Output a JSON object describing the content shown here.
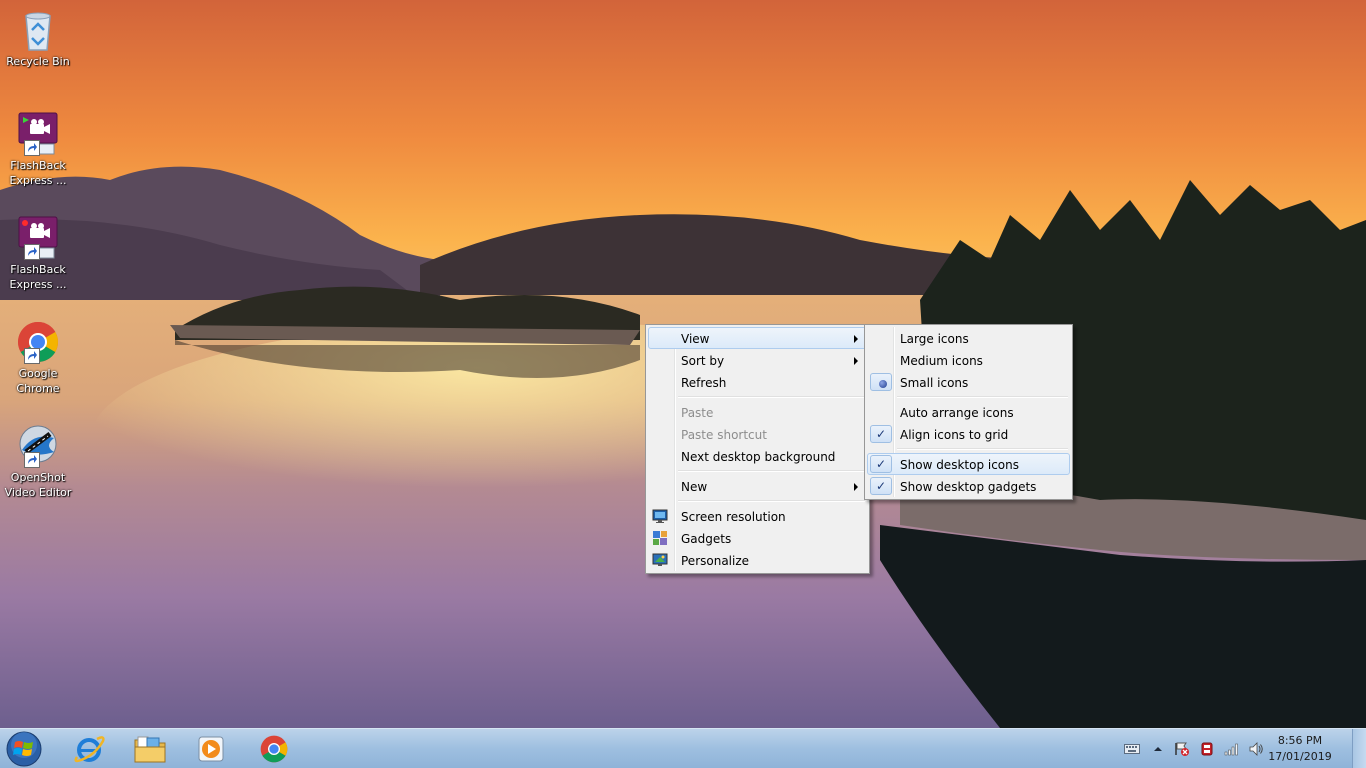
{
  "desktop": {
    "icons": [
      {
        "id": "recycle-bin",
        "label": "Recycle Bin",
        "icon": "recycle-bin-icon"
      },
      {
        "id": "flashback-recorder",
        "label": "FlashBack Express ...",
        "icon": "flashback-recorder-icon"
      },
      {
        "id": "flashback-player",
        "label": "FlashBack Express ...",
        "icon": "flashback-player-icon"
      },
      {
        "id": "google-chrome",
        "label": "Google Chrome",
        "icon": "chrome-icon"
      },
      {
        "id": "openshot",
        "label": "OpenShot Video Editor",
        "icon": "openshot-icon"
      }
    ]
  },
  "context_menu": {
    "items": {
      "view": "View",
      "sort_by": "Sort by",
      "refresh": "Refresh",
      "paste": "Paste",
      "paste_shortcut": "Paste shortcut",
      "next_background": "Next desktop background",
      "new": "New",
      "screen_resolution": "Screen resolution",
      "gadgets": "Gadgets",
      "personalize": "Personalize"
    },
    "disabled": [
      "Paste",
      "Paste shortcut"
    ],
    "highlighted": "View"
  },
  "view_submenu": {
    "items": {
      "large_icons": "Large icons",
      "medium_icons": "Medium icons",
      "small_icons": "Small icons",
      "auto_arrange": "Auto arrange icons",
      "align_grid": "Align icons to grid",
      "show_icons": "Show desktop icons",
      "show_gadgets": "Show desktop gadgets"
    },
    "selected_size": "Small icons",
    "checked": [
      "Align icons to grid",
      "Show desktop icons",
      "Show desktop gadgets"
    ],
    "highlighted": "Show desktop icons",
    "check_mark": "✓"
  },
  "taskbar": {
    "pinned": [
      "internet-explorer-icon",
      "file-explorer-icon",
      "media-player-icon",
      "chrome-icon"
    ],
    "clock": {
      "time": "8:56 PM",
      "date": "17/01/2019"
    },
    "tray_icons": [
      "keyboard-icon",
      "show-hidden-icons-arrow",
      "action-center-icon",
      "antivirus-icon",
      "network-signal-icon",
      "volume-icon"
    ]
  },
  "colors": {
    "menu_bg": "#f0f0f0",
    "menu_hover": "#dceaf9",
    "taskbar": "#9ebfe0",
    "sky_top": "#d2643a",
    "sky_horizon": "#fbb34d"
  }
}
